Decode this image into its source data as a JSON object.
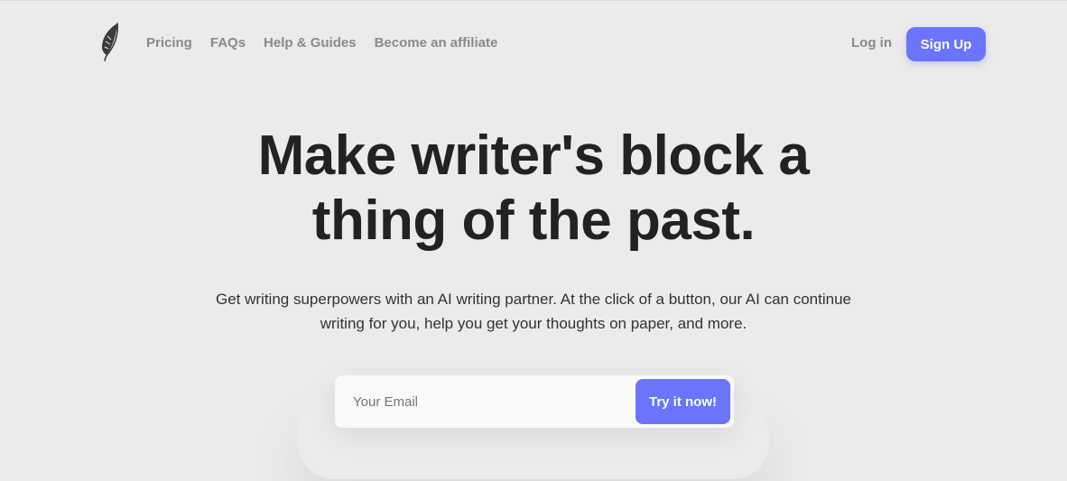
{
  "nav": {
    "logo_icon": "feather-icon",
    "links": [
      {
        "label": "Pricing"
      },
      {
        "label": "FAQs"
      },
      {
        "label": "Help & Guides"
      },
      {
        "label": "Become an affiliate"
      }
    ],
    "login_label": "Log in",
    "signup_label": "Sign Up"
  },
  "hero": {
    "title_line1": "Make writer's block a",
    "title_line2": "thing of the past.",
    "subtitle_line1": "Get writing superpowers with an AI writing partner. At the click of a button, our AI can continue",
    "subtitle_line2": "writing for you, help you get your thoughts on paper, and more."
  },
  "signup_form": {
    "email_placeholder": "Your Email",
    "submit_label": "Try it now!"
  },
  "colors": {
    "background": "#ebebeb",
    "accent": "#6b73ff",
    "nav_text": "#8a8a8a",
    "heading": "#222222"
  }
}
